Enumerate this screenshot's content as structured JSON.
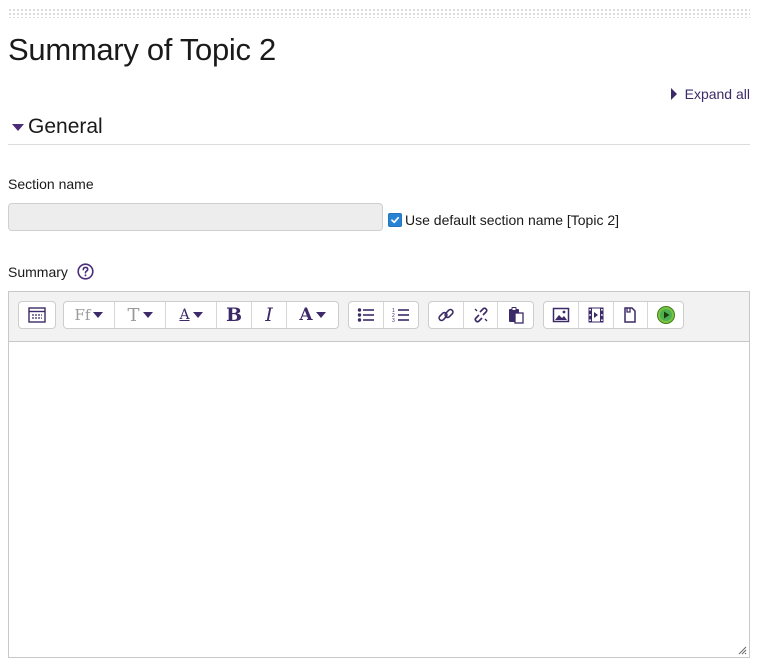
{
  "page": {
    "title": "Summary of Topic 2",
    "expand_all_label": "Expand all"
  },
  "section": {
    "title": "General"
  },
  "form": {
    "section_name_label": "Section name",
    "section_name_value": "",
    "use_default_label": "Use default section name [Topic 2]",
    "use_default_checked": true,
    "summary_label": "Summary"
  },
  "editor": {
    "content": "",
    "toolbar_groups": [
      [
        "collapse-icon"
      ],
      [
        "font-family-dropdown",
        "font-size-dropdown",
        "paragraph-style-dropdown",
        "bold-icon",
        "italic-icon",
        "text-color-dropdown"
      ],
      [
        "bullet-list-icon",
        "numbered-list-icon"
      ],
      [
        "link-icon",
        "unlink-icon",
        "paste-icon"
      ],
      [
        "image-icon",
        "media-icon",
        "file-icon",
        "video-play-icon"
      ]
    ],
    "font_family_glyph": "Ff",
    "font_size_glyph": "T",
    "style_glyph": "A",
    "bold_glyph": "B",
    "italic_glyph": "I",
    "color_glyph": "A"
  },
  "colors": {
    "accent": "#3c2a68",
    "checkbox": "#2a82d4",
    "input_bg": "#ededed",
    "toolbar_bg": "#f2f2f2",
    "media_play": "#4caf50"
  }
}
